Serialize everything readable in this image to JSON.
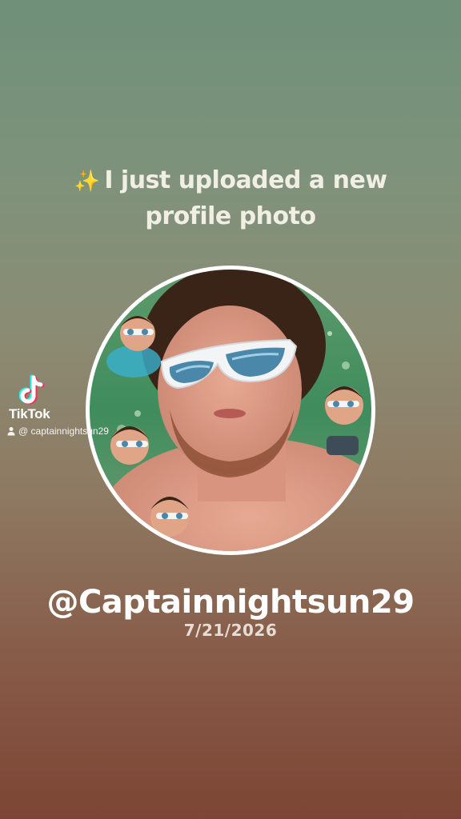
{
  "post": {
    "sparkle_icon": "sparkles-icon",
    "headline": "I just uploaded a new profile photo",
    "handle": "@Captainnightsun29",
    "date": "7/21/2026"
  },
  "watermark": {
    "brand": "TikTok",
    "username": "@ captainnightsun29",
    "logo_icon": "tiktok-logo-icon",
    "user_icon": "person-icon"
  },
  "colors": {
    "background_top": "#6f9079",
    "background_bottom": "#7d4535",
    "photo_ring": "#ffffff",
    "text": "#ffffff"
  }
}
